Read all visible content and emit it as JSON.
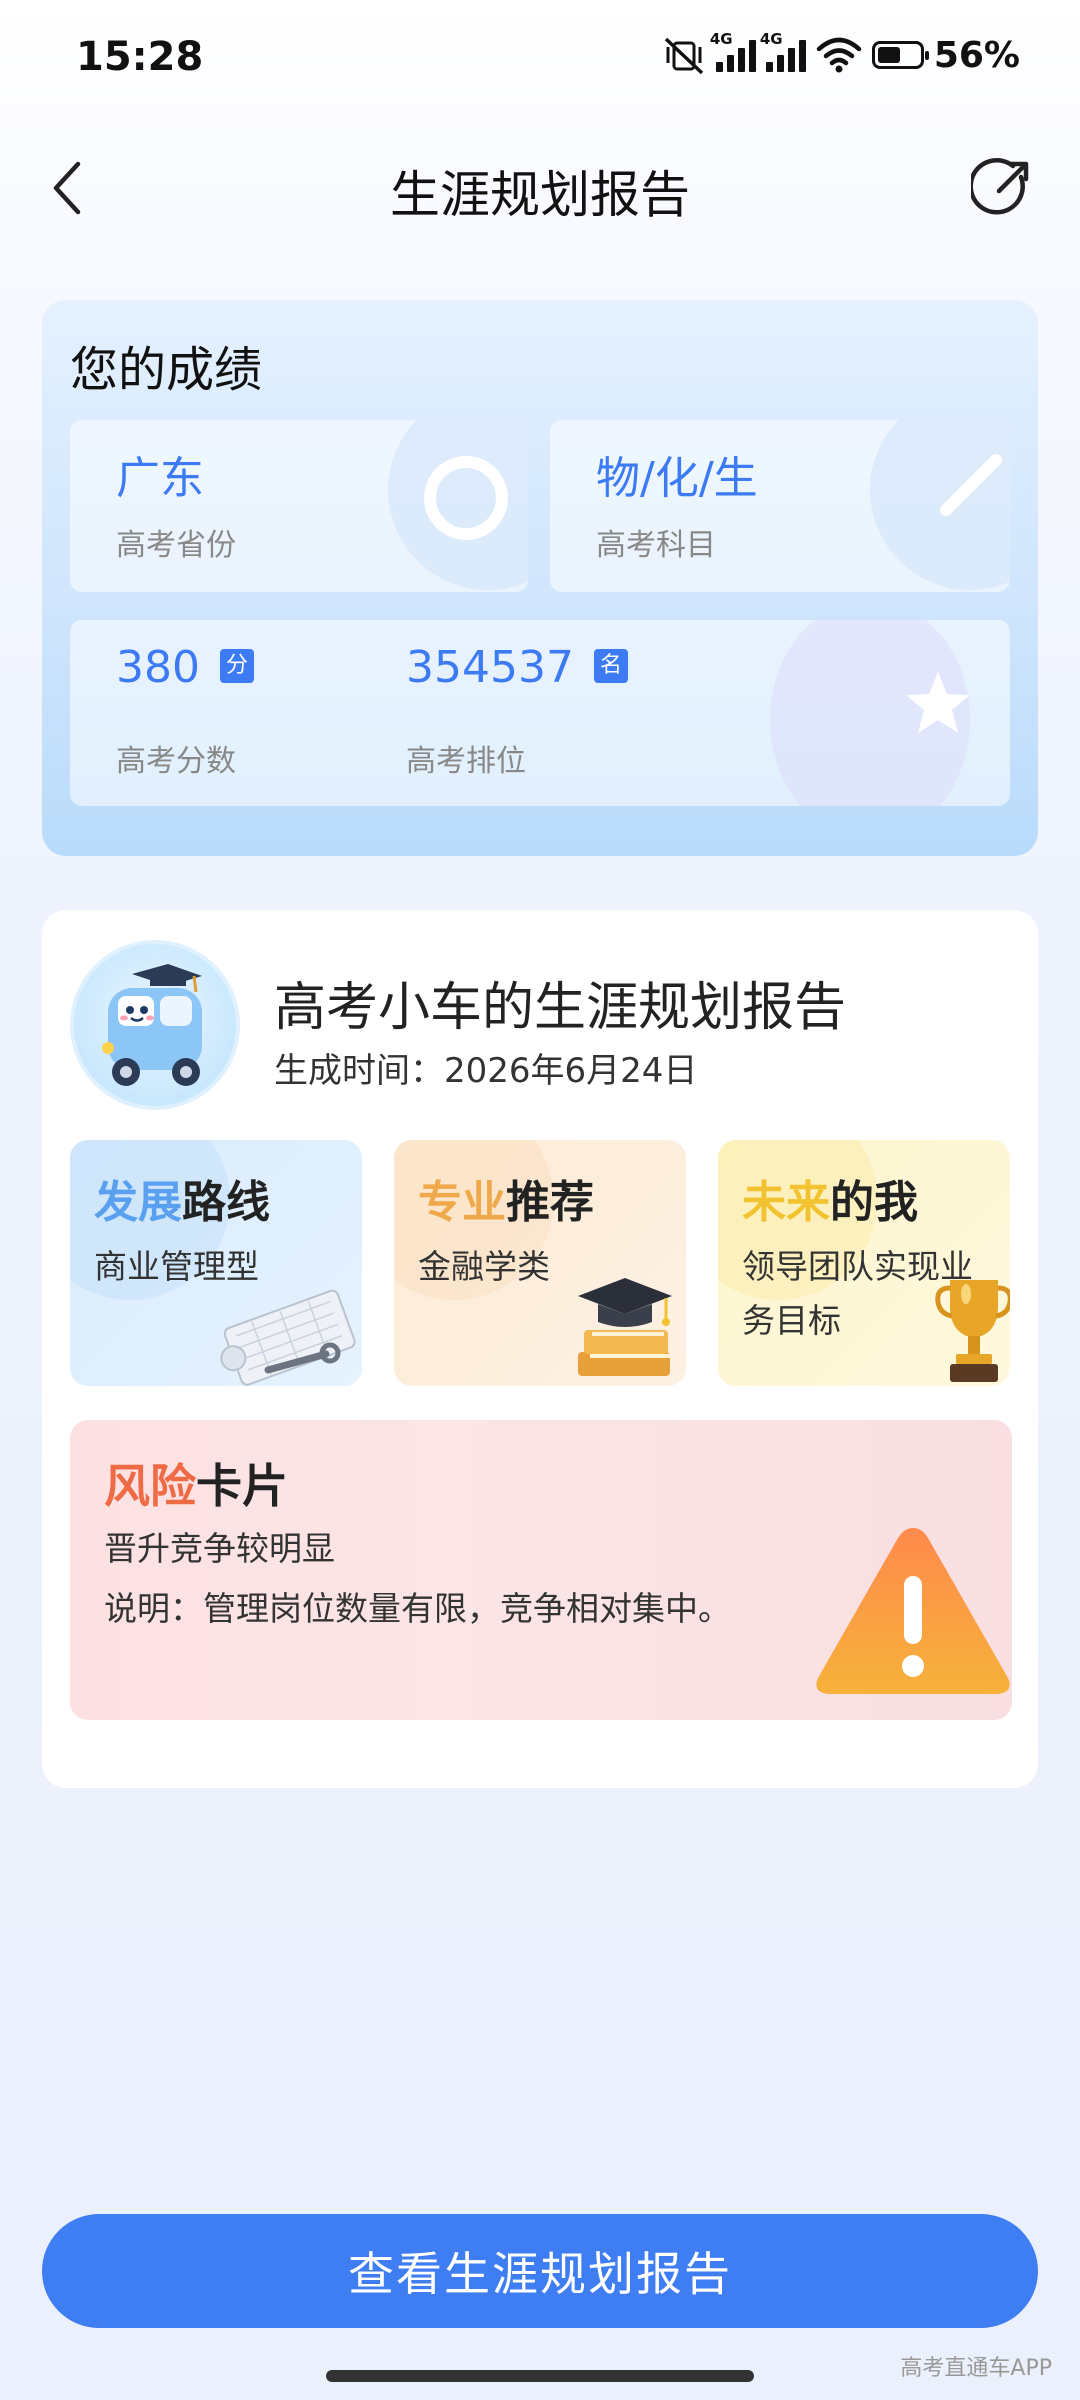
{
  "status_bar": {
    "time": "15:28",
    "battery_text": "56%",
    "battery_level": 0.56,
    "network_1": "4G",
    "network_2": "4G"
  },
  "header": {
    "title": "生涯规划报告",
    "back_icon": "chevron-left-icon",
    "share_icon": "share-icon"
  },
  "scores": {
    "heading": "您的成绩",
    "province": {
      "value": "广东",
      "label": "高考省份"
    },
    "subjects": {
      "value": "物/化/生",
      "label": "高考科目"
    },
    "score": {
      "value": "380",
      "unit": "分",
      "label": "高考分数"
    },
    "rank": {
      "value": "354537",
      "unit": "名",
      "label": "高考排位"
    }
  },
  "report": {
    "title": "高考小车的生涯规划报告",
    "time": "生成时间：2026年6月24日",
    "cards": [
      {
        "title_highlight": "发展",
        "title_rest": "路线",
        "value": "商业管理型",
        "highlight_color": "#5aa0f0"
      },
      {
        "title_highlight": "专业",
        "title_rest": "推荐",
        "value": "金融学类",
        "highlight_color": "#f0a94a"
      },
      {
        "title_highlight": "未来",
        "title_rest": "的我",
        "value": "领导团队实现业务目标",
        "highlight_color": "#f2c230"
      }
    ],
    "risk": {
      "title_highlight": "风险",
      "title_rest": "卡片",
      "subtitle": "晋升竞争较明显",
      "desc": "说明：管理岗位数量有限，竞争相对集中。",
      "highlight_color": "#ef6b45"
    }
  },
  "cta": {
    "label": "查看生涯规划报告"
  },
  "watermark": "高考直通车APP",
  "colors": {
    "accent": "#3f7df3",
    "score_text": "#3d7bf4"
  }
}
